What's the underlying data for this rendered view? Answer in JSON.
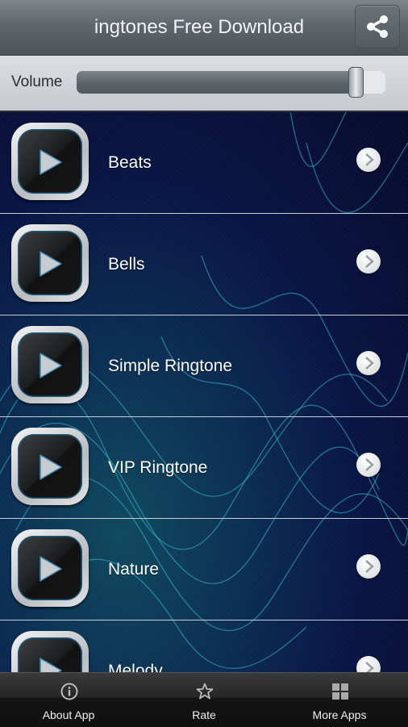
{
  "header": {
    "title": "ingtones Free Download",
    "share_icon": "share-icon"
  },
  "volume": {
    "label": "Volume",
    "level_percent": 90
  },
  "ringtones": [
    {
      "label": "Beats",
      "icon": "play-icon",
      "chevron": "chevron-right-icon"
    },
    {
      "label": "Bells",
      "icon": "play-icon",
      "chevron": "chevron-right-icon"
    },
    {
      "label": "Simple Ringtone",
      "icon": "play-icon",
      "chevron": "chevron-right-icon"
    },
    {
      "label": "VIP Ringtone",
      "icon": "play-icon",
      "chevron": "chevron-right-icon"
    },
    {
      "label": "Nature",
      "icon": "play-icon",
      "chevron": "chevron-right-icon"
    },
    {
      "label": "Melody",
      "icon": "play-icon",
      "chevron": "chevron-right-icon"
    }
  ],
  "bottom_nav": [
    {
      "label": "About App",
      "icon": "info-icon"
    },
    {
      "label": "Rate",
      "icon": "star-icon"
    },
    {
      "label": "More Apps",
      "icon": "grid-icon"
    }
  ],
  "colors": {
    "background": "#070b2a",
    "wave": "#2fb6c8",
    "header": "#5d656b",
    "volume_bar": "#d2d5d8",
    "bottom_bar": "#141414"
  }
}
